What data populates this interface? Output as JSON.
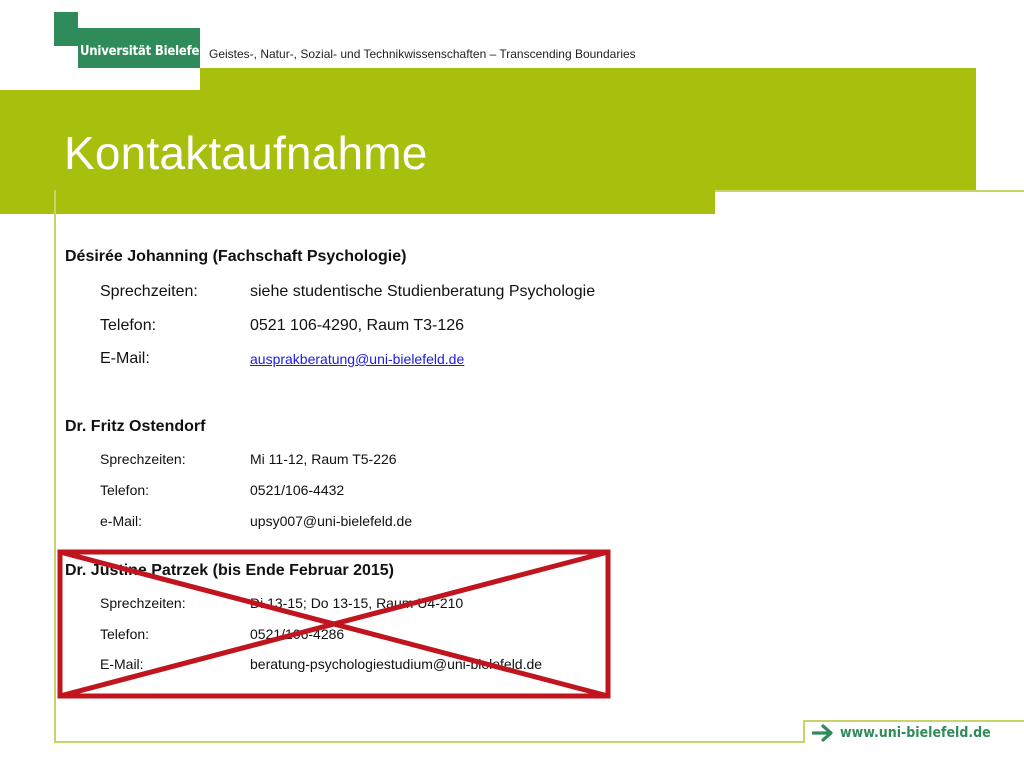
{
  "header": {
    "logo_text": "Universität Bielefeld",
    "tagline": "Geistes-, Natur-, Sozial- und Technikwissenschaften – Transcending Boundaries",
    "title": "Kontaktaufnahme"
  },
  "contacts": [
    {
      "name": "Désirée Johanning (Fachschaft Psychologie)",
      "rows": [
        {
          "label": "Sprechzeiten:",
          "value": "siehe studentische Studienberatung Psychologie"
        },
        {
          "label": "Telefon:",
          "value": "0521 106-4290, Raum T3-126"
        },
        {
          "label": "E-Mail:",
          "value": "ausprakberatung@uni-bielefeld.de"
        }
      ]
    },
    {
      "name": "Dr. Fritz Ostendorf",
      "rows": [
        {
          "label": "Sprechzeiten:",
          "value": "Mi 11-12, Raum T5-226"
        },
        {
          "label": "Telefon:",
          "value": "0521/106-4432"
        },
        {
          "label": "e-Mail:",
          "value": "upsy007@uni-bielefeld.de"
        }
      ]
    },
    {
      "name": "Dr. Justine Patrzek (bis Ende Februar 2015)",
      "crossed_out": true,
      "rows": [
        {
          "label": "Sprechzeiten:",
          "value": "Di 13-15; Do 13-15, Raum U4-210"
        },
        {
          "label": "Telefon:",
          "value": "0521/106-4286"
        },
        {
          "label": "E-Mail:",
          "value": "beratung-psychologiestudium@uni-bielefeld.de"
        }
      ]
    }
  ],
  "footer": {
    "url": "www.uni-bielefeld.de",
    "arrow_icon": "arrow-right-icon"
  },
  "colors": {
    "brand_green": "#2f8b5a",
    "accent_lime": "#a9bf0d",
    "cross_red": "#c0151f"
  }
}
